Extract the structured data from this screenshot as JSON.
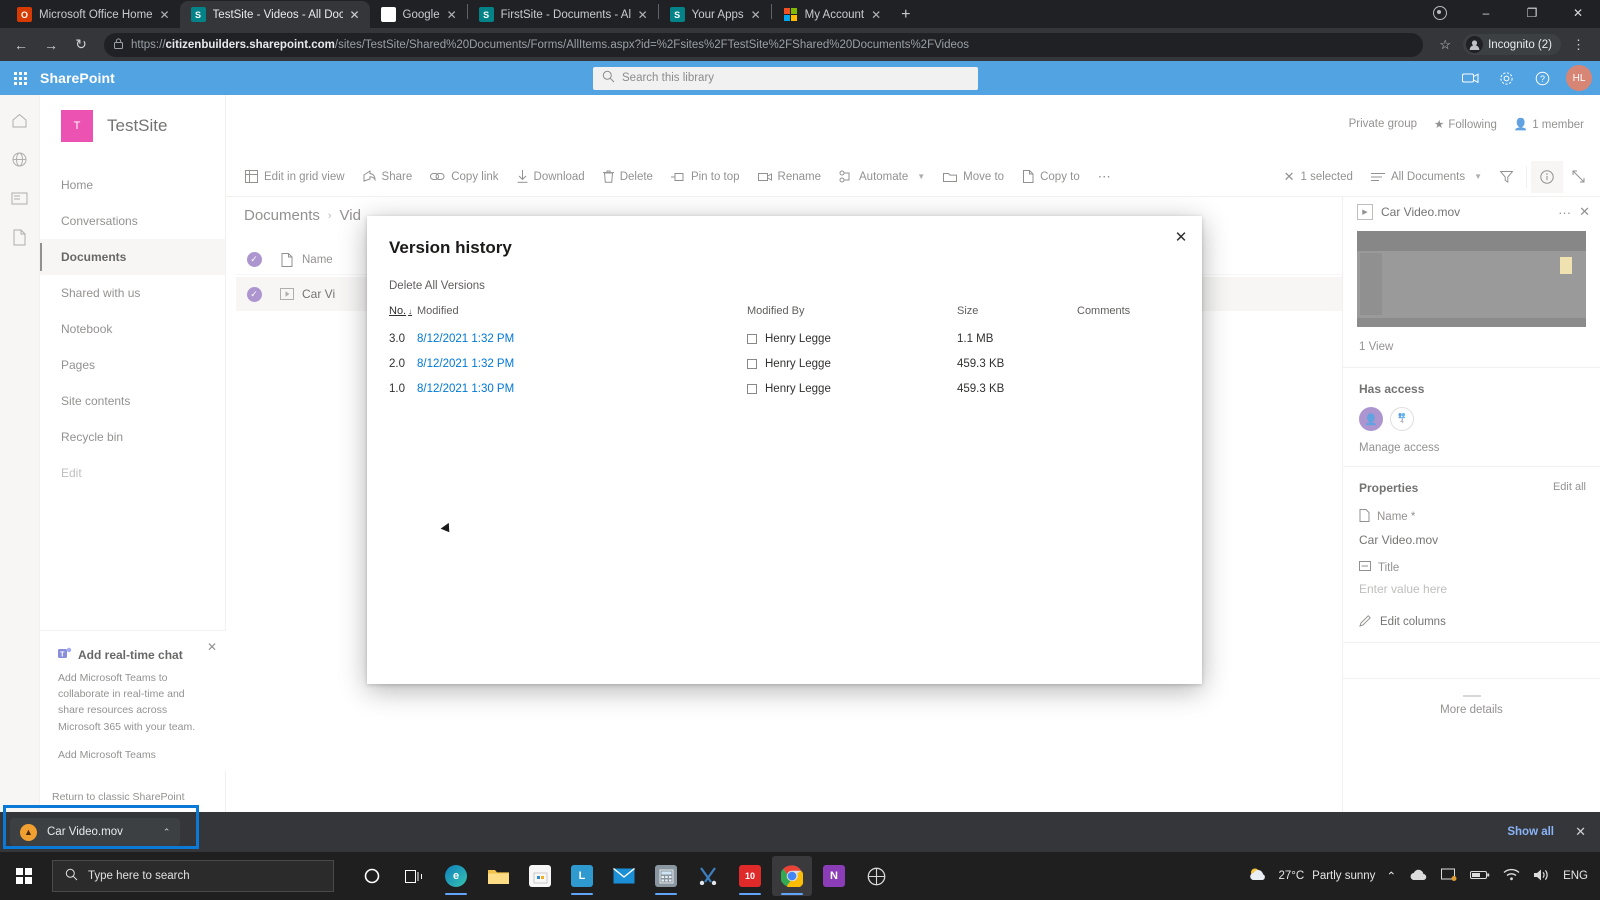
{
  "browser": {
    "tabs": [
      {
        "title": "Microsoft Office Home",
        "favicon": "office-icon",
        "active": false
      },
      {
        "title": "TestSite - Videos - All Documents",
        "favicon": "sharepoint-icon",
        "active": true
      },
      {
        "title": "Google",
        "favicon": "google-icon",
        "active": false
      },
      {
        "title": "FirstSite - Documents - All Docu",
        "favicon": "sharepoint-icon",
        "active": false
      },
      {
        "title": "Your Apps",
        "favicon": "sharepoint-icon",
        "active": false
      },
      {
        "title": "My Account",
        "favicon": "microsoft-icon",
        "active": false
      }
    ],
    "new_tab_label": "+",
    "close_label": "✕",
    "window_controls": {
      "minimize": "–",
      "maximize": "❐",
      "close": "✕"
    },
    "nav": {
      "back": "←",
      "forward": "→",
      "reload": "↻"
    },
    "url": {
      "lock": "🔒",
      "scheme": "https://",
      "host": "citizenbuilders.sharepoint.com",
      "path": "/sites/TestSite/Shared%20Documents/Forms/AllItems.aspx?id=%2Fsites%2FTestSite%2FShared%20Documents%2FVideos"
    },
    "star_label": "☆",
    "profile": {
      "label": "Incognito (2)"
    },
    "menu_label": "⋮"
  },
  "suitebar": {
    "waffle_name": "app-launcher-icon",
    "brand": "SharePoint",
    "search_placeholder": "Search this library",
    "search_value": "",
    "icons": [
      "teams-icon",
      "gear-icon",
      "help-icon"
    ],
    "avatar_initials": "HL"
  },
  "site": {
    "logo_letter": "T",
    "title": "TestSite",
    "privacy": "Private group",
    "following": "Following",
    "members": "1 member",
    "nav_items": [
      {
        "label": "Home",
        "selected": false
      },
      {
        "label": "Conversations",
        "selected": false
      },
      {
        "label": "Documents",
        "selected": true
      },
      {
        "label": "Shared with us",
        "selected": false
      },
      {
        "label": "Notebook",
        "selected": false
      },
      {
        "label": "Pages",
        "selected": false
      },
      {
        "label": "Site contents",
        "selected": false
      },
      {
        "label": "Recycle bin",
        "selected": false
      },
      {
        "label": "Edit",
        "selected": false
      }
    ],
    "rail_icons": [
      "home-icon",
      "globe-icon",
      "news-icon",
      "files-icon"
    ]
  },
  "commandbar": {
    "commands": [
      {
        "label": "Edit in grid view",
        "icon": "grid-icon",
        "has_chevron": false
      },
      {
        "label": "Share",
        "icon": "share-icon",
        "has_chevron": false
      },
      {
        "label": "Copy link",
        "icon": "link-icon",
        "has_chevron": false
      },
      {
        "label": "Download",
        "icon": "download-icon",
        "has_chevron": false
      },
      {
        "label": "Delete",
        "icon": "trash-icon",
        "has_chevron": false
      },
      {
        "label": "Pin to top",
        "icon": "pin-icon",
        "has_chevron": false
      },
      {
        "label": "Rename",
        "icon": "rename-icon",
        "has_chevron": false
      },
      {
        "label": "Automate",
        "icon": "automate-icon",
        "has_chevron": true
      },
      {
        "label": "Move to",
        "icon": "move-icon",
        "has_chevron": false
      },
      {
        "label": "Copy to",
        "icon": "copy-icon",
        "has_chevron": false
      },
      {
        "label": "",
        "icon": "more-icon",
        "has_chevron": false
      }
    ],
    "selection_count": "1 selected",
    "view_name": "All Documents",
    "filter_icon": "filter-icon",
    "info_icon": "info-icon",
    "expand_icon": "expand-icon"
  },
  "breadcrumb": {
    "root": "Documents",
    "separator": "›",
    "current": "Vid"
  },
  "filelist": {
    "headers": {
      "name": "Name"
    },
    "rows": [
      {
        "name": "Car Vi"
      }
    ]
  },
  "modal": {
    "title": "Version history",
    "close_label": "✕",
    "delete_all_label": "Delete All Versions",
    "columns": [
      "No.",
      "Modified",
      "Modified By",
      "Size",
      "Comments"
    ],
    "sort_arrow": "↓",
    "rows": [
      {
        "no": "3.0",
        "modified": "8/12/2021 1:32 PM",
        "modified_by": "Henry Legge",
        "size": "1.1 MB",
        "comments": ""
      },
      {
        "no": "2.0",
        "modified": "8/12/2021 1:32 PM",
        "modified_by": "Henry Legge",
        "size": "459.3 KB",
        "comments": ""
      },
      {
        "no": "1.0",
        "modified": "8/12/2021 1:30 PM",
        "modified_by": "Henry Legge",
        "size": "459.3 KB",
        "comments": ""
      }
    ]
  },
  "details_pane": {
    "file_name": "Car Video.mov",
    "more_label": "···",
    "close_label": "✕",
    "views": "1 View",
    "has_access_title": "Has access",
    "access_extra_count": "4",
    "manage_access": "Manage access",
    "properties_title": "Properties",
    "edit_all": "Edit all",
    "name_label": "Name *",
    "name_value": "Car Video.mov",
    "title_label": "Title",
    "title_placeholder": "Enter value here",
    "edit_columns": "Edit columns",
    "more_details": "More details"
  },
  "teams_card": {
    "title": "Add real-time chat",
    "body": "Add Microsoft Teams to collaborate in real-time and share resources across Microsoft 365 with your team.",
    "link": "Add Microsoft Teams",
    "close_label": "✕",
    "classic_link": "Return to classic SharePoint"
  },
  "download_bar": {
    "file_name": "Car Video.mov",
    "chevron": "⌃",
    "show_all": "Show all",
    "close_label": "✕"
  },
  "taskbar": {
    "search_placeholder": "Type here to search",
    "apps": [
      {
        "name": "cortana-icon",
        "label": "O",
        "color": "transparent"
      },
      {
        "name": "task-view-icon",
        "label": "⧉",
        "color": "transparent"
      },
      {
        "name": "edge-icon",
        "label": "e",
        "color": "#1b8fd6"
      },
      {
        "name": "file-explorer-icon",
        "label": "📁",
        "color": "#f0b429"
      },
      {
        "name": "microsoft-store-icon",
        "label": "⬜",
        "color": "#f5f5f5"
      },
      {
        "name": "linkedin-icon",
        "label": "L",
        "color": "#29a8e0"
      },
      {
        "name": "mail-icon",
        "label": "✉",
        "color": "#1b8fd6"
      },
      {
        "name": "calculator-icon",
        "label": "⌗",
        "color": "#7b8a95"
      },
      {
        "name": "snip-tool-icon",
        "label": "✂",
        "color": "#2f6fb5"
      },
      {
        "name": "camtasia-icon",
        "label": "10",
        "color": "#e02a2a"
      },
      {
        "name": "chrome-icon",
        "label": "●",
        "color": "#dd4b3e"
      },
      {
        "name": "onenote-icon",
        "label": "N",
        "color": "#8a3db6"
      },
      {
        "name": "settings-app-icon",
        "label": "⚙",
        "color": "#5b6770"
      }
    ],
    "weather": {
      "temp": "27°C",
      "condition": "Partly sunny",
      "icon": "partly-sunny-icon"
    },
    "tray": [
      "chevron-up-icon",
      "onedrive-icon",
      "screen-icon",
      "battery-icon",
      "wifi-icon",
      "volume-icon"
    ],
    "language": "ENG"
  }
}
